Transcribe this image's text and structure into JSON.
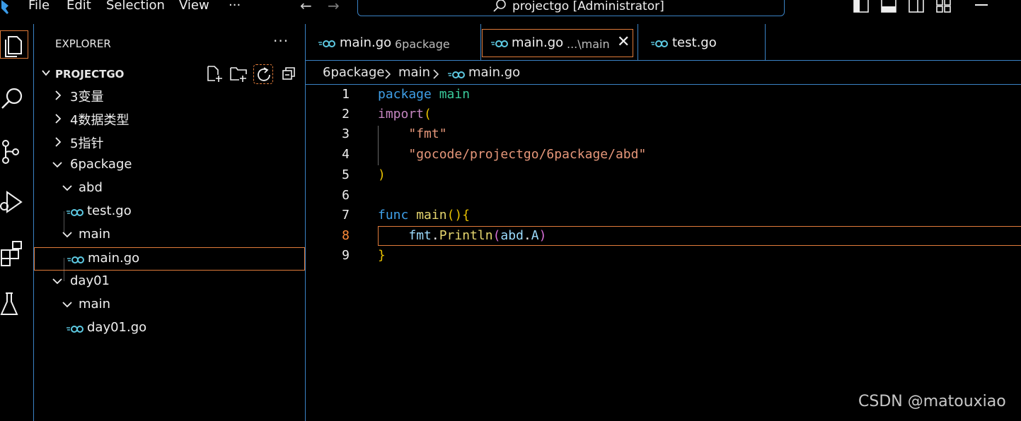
{
  "menu": {
    "file": "File",
    "edit": "Edit",
    "selection": "Selection",
    "view": "View",
    "more": "···"
  },
  "search": {
    "text": "projectgo [Administrator]"
  },
  "sidebar": {
    "title": "EXPLORER",
    "more": "···",
    "project": "PROJECTGO",
    "tree": [
      {
        "label": "3变量"
      },
      {
        "label": "4数据类型"
      },
      {
        "label": "5指针"
      },
      {
        "label": "6package"
      },
      {
        "label": "abd"
      },
      {
        "label": "test.go"
      },
      {
        "label": "main"
      },
      {
        "label": "main.go"
      },
      {
        "label": "day01"
      },
      {
        "label": "main"
      },
      {
        "label": "day01.go"
      }
    ]
  },
  "tabs": [
    {
      "name": "main.go",
      "desc": "6package"
    },
    {
      "name": "main.go",
      "desc": "...\\main",
      "close": "✕"
    },
    {
      "name": "test.go"
    }
  ],
  "breadcrumb": [
    "6package",
    "main",
    "main.go"
  ],
  "editor": {
    "line_numbers": [
      "1",
      "2",
      "3",
      "4",
      "5",
      "6",
      "7",
      "8",
      "9"
    ],
    "current_line": "8",
    "tokens": {
      "l1_kw": "package",
      "l1_name": "main",
      "l2_kw": "import",
      "l2_paren": "(",
      "l3_str": "\"fmt\"",
      "l4_str": "\"gocode/projectgo/6package/abd\"",
      "l5_paren": ")",
      "l7_kw": "func",
      "l7_name": "main",
      "l7_parens": "()",
      "l7_brace": "{",
      "l8_pkg": "fmt",
      "l8_dot": ".",
      "l8_fn": "Println",
      "l8_open": "(",
      "l8_arg": "abd",
      "l8_dot2": ".",
      "l8_field": "A",
      "l8_close": ")",
      "l9_brace": "}"
    }
  },
  "watermark": "CSDN @matouxiao",
  "colors": {
    "accent": "#3a82c4",
    "focus": "#e07b3a"
  }
}
